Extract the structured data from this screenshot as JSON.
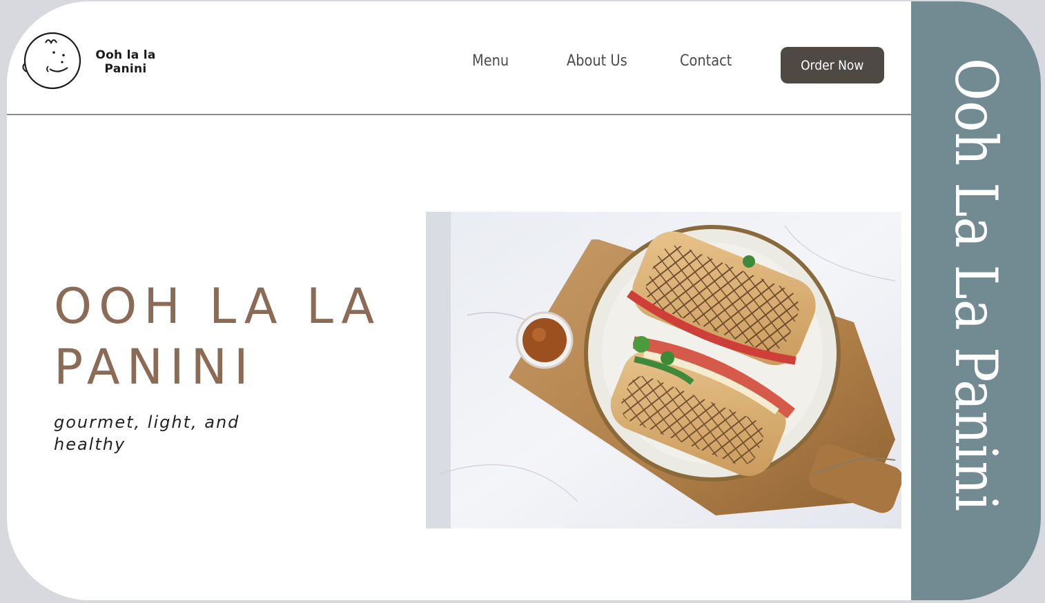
{
  "brand": {
    "logo_text_line1": "Ooh la la",
    "logo_text_line2": "Panini",
    "logo_icon": "smiling-face-logo"
  },
  "nav": {
    "items": [
      {
        "label": "Menu"
      },
      {
        "label": "About Us"
      },
      {
        "label": "Contact"
      }
    ],
    "cta_label": "Order Now"
  },
  "hero": {
    "title_line1": "OOH LA LA",
    "title_line2": "PANINI",
    "subtitle": "gourmet, light, and healthy",
    "image": "panini-on-plate-photo"
  },
  "side_banner": {
    "text": "Ooh La La Panini"
  },
  "colors": {
    "accent_brown": "#8b6b55",
    "button_dark": "#4f4943",
    "side_panel": "#728b93",
    "background": "#ffffff"
  }
}
